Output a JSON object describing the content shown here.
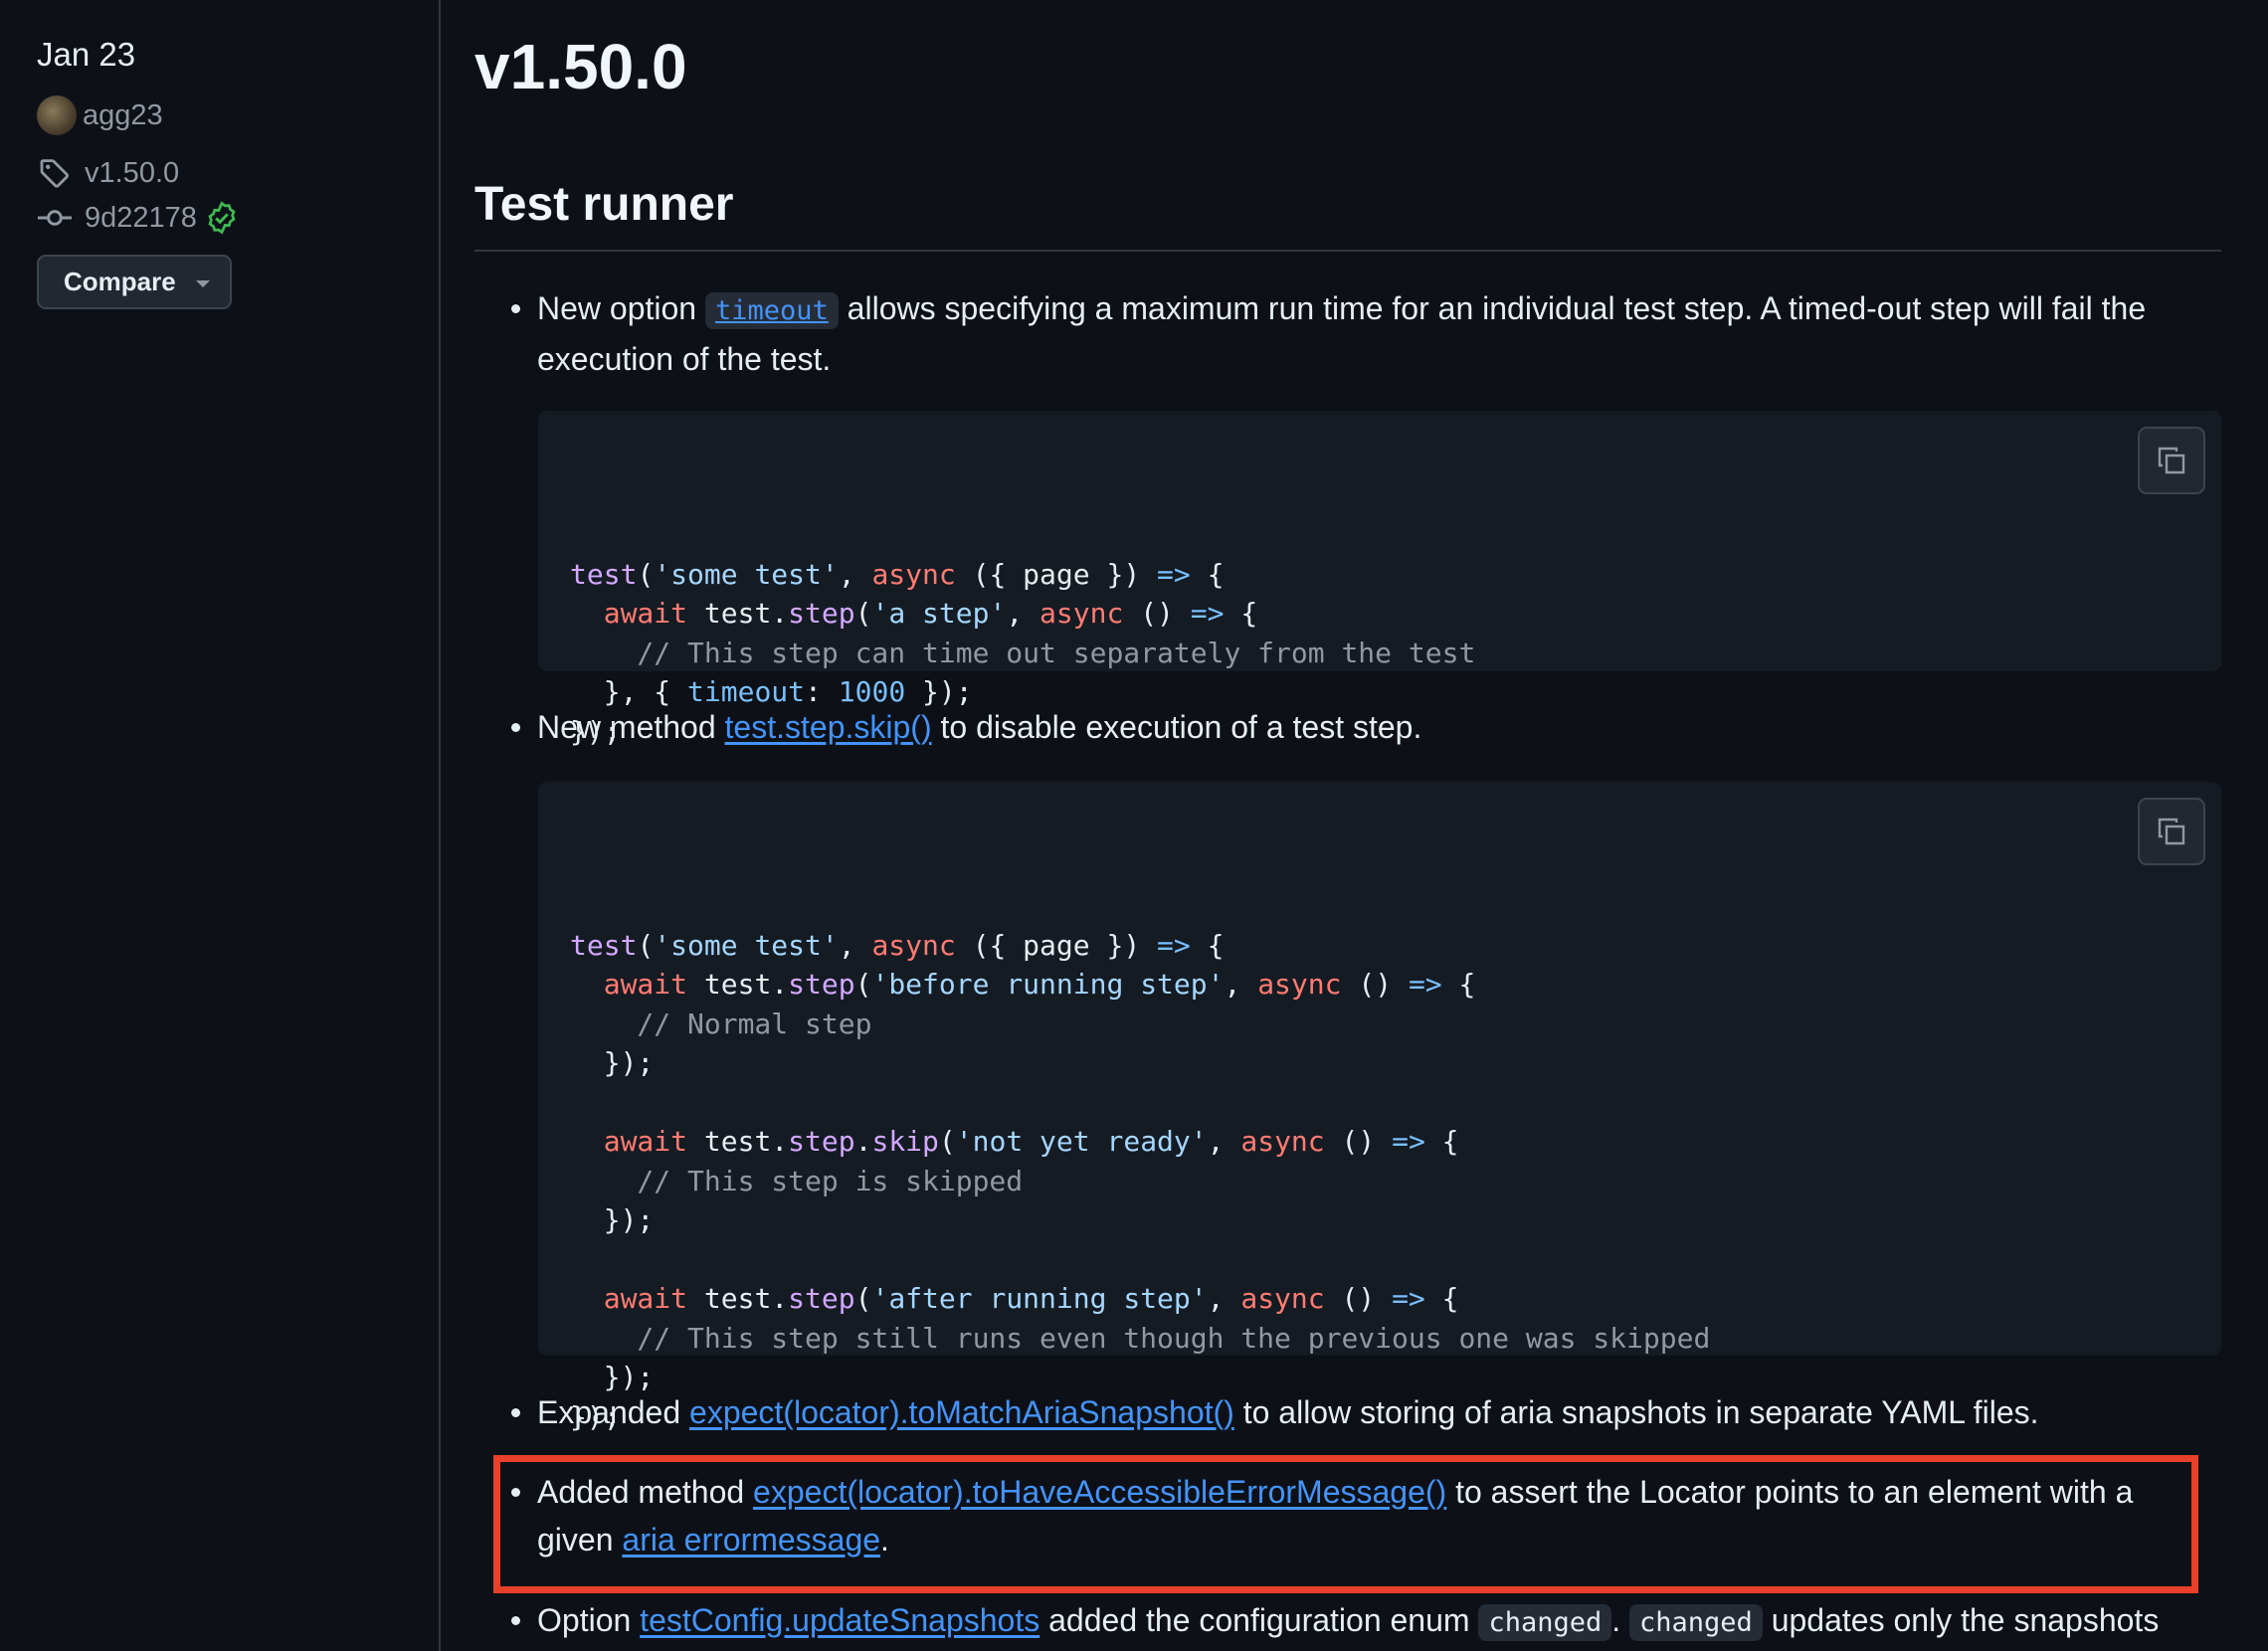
{
  "sidebar": {
    "date": "Jan 23",
    "author": "agg23",
    "tag": "v1.50.0",
    "commit": "9d22178",
    "compare_label": "Compare"
  },
  "release": {
    "title": "v1.50.0",
    "section_title": "Test runner"
  },
  "bullets": {
    "b1": {
      "pre": "New option ",
      "code": "timeout",
      "post": " allows specifying a maximum run time for an individual test step. A timed-out step will fail the execution of the test."
    },
    "b2": {
      "pre": "New method ",
      "link": "test.step.skip()",
      "post": " to disable execution of a test step."
    },
    "b3": {
      "pre": "Expanded ",
      "link": "expect(locator).toMatchAriaSnapshot()",
      "post": " to allow storing of aria snapshots in separate YAML files."
    },
    "b4": {
      "pre": "Added method ",
      "link": "expect(locator).toHaveAccessibleErrorMessage()",
      "mid": " to assert the Locator points to an element with a given ",
      "link2": "aria errormessage",
      "post": "."
    },
    "b5": {
      "pre": "Option ",
      "link": "testConfig.updateSnapshots",
      "mid": " added the configuration enum ",
      "code1": "changed",
      "sep": ". ",
      "code2": "changed",
      "post": " updates only the snapshots"
    }
  },
  "code1": [
    [
      [
        "f",
        "test"
      ],
      [
        "p",
        "("
      ],
      [
        "s",
        "'some test'"
      ],
      [
        "p",
        ", "
      ],
      [
        "k",
        "async"
      ],
      [
        "p",
        " ({ page }) "
      ],
      [
        "o",
        "=>"
      ],
      [
        "p",
        " {"
      ]
    ],
    [
      [
        "p",
        "  "
      ],
      [
        "k",
        "await"
      ],
      [
        "p",
        " test."
      ],
      [
        "f",
        "step"
      ],
      [
        "p",
        "("
      ],
      [
        "s",
        "'a step'"
      ],
      [
        "p",
        ", "
      ],
      [
        "k",
        "async"
      ],
      [
        "p",
        " () "
      ],
      [
        "o",
        "=>"
      ],
      [
        "p",
        " {"
      ]
    ],
    [
      [
        "c",
        "    // This step can time out separately from the test"
      ]
    ],
    [
      [
        "p",
        "  }, { "
      ],
      [
        "o",
        "timeout"
      ],
      [
        "p",
        ": "
      ],
      [
        "n",
        "1000"
      ],
      [
        "p",
        " });"
      ]
    ],
    [
      [
        "p",
        "});"
      ]
    ]
  ],
  "code2": [
    [
      [
        "f",
        "test"
      ],
      [
        "p",
        "("
      ],
      [
        "s",
        "'some test'"
      ],
      [
        "p",
        ", "
      ],
      [
        "k",
        "async"
      ],
      [
        "p",
        " ({ page }) "
      ],
      [
        "o",
        "=>"
      ],
      [
        "p",
        " {"
      ]
    ],
    [
      [
        "p",
        "  "
      ],
      [
        "k",
        "await"
      ],
      [
        "p",
        " test."
      ],
      [
        "f",
        "step"
      ],
      [
        "p",
        "("
      ],
      [
        "s",
        "'before running step'"
      ],
      [
        "p",
        ", "
      ],
      [
        "k",
        "async"
      ],
      [
        "p",
        " () "
      ],
      [
        "o",
        "=>"
      ],
      [
        "p",
        " {"
      ]
    ],
    [
      [
        "c",
        "    // Normal step"
      ]
    ],
    [
      [
        "p",
        "  });"
      ]
    ],
    [
      [
        "p",
        ""
      ]
    ],
    [
      [
        "p",
        "  "
      ],
      [
        "k",
        "await"
      ],
      [
        "p",
        " test."
      ],
      [
        "f",
        "step"
      ],
      [
        "p",
        "."
      ],
      [
        "f",
        "skip"
      ],
      [
        "p",
        "("
      ],
      [
        "s",
        "'not yet ready'"
      ],
      [
        "p",
        ", "
      ],
      [
        "k",
        "async"
      ],
      [
        "p",
        " () "
      ],
      [
        "o",
        "=>"
      ],
      [
        "p",
        " {"
      ]
    ],
    [
      [
        "c",
        "    // This step is skipped"
      ]
    ],
    [
      [
        "p",
        "  });"
      ]
    ],
    [
      [
        "p",
        ""
      ]
    ],
    [
      [
        "p",
        "  "
      ],
      [
        "k",
        "await"
      ],
      [
        "p",
        " test."
      ],
      [
        "f",
        "step"
      ],
      [
        "p",
        "("
      ],
      [
        "s",
        "'after running step'"
      ],
      [
        "p",
        ", "
      ],
      [
        "k",
        "async"
      ],
      [
        "p",
        " () "
      ],
      [
        "o",
        "=>"
      ],
      [
        "p",
        " {"
      ]
    ],
    [
      [
        "c",
        "    // This step still runs even though the previous one was skipped"
      ]
    ],
    [
      [
        "p",
        "  });"
      ]
    ],
    [
      [
        "p",
        "});"
      ]
    ]
  ],
  "colors": {
    "background": "#0d1117",
    "code_background": "#151b23",
    "link": "#4493f8",
    "highlight_border": "#e8402a",
    "verified": "#3fb950"
  }
}
